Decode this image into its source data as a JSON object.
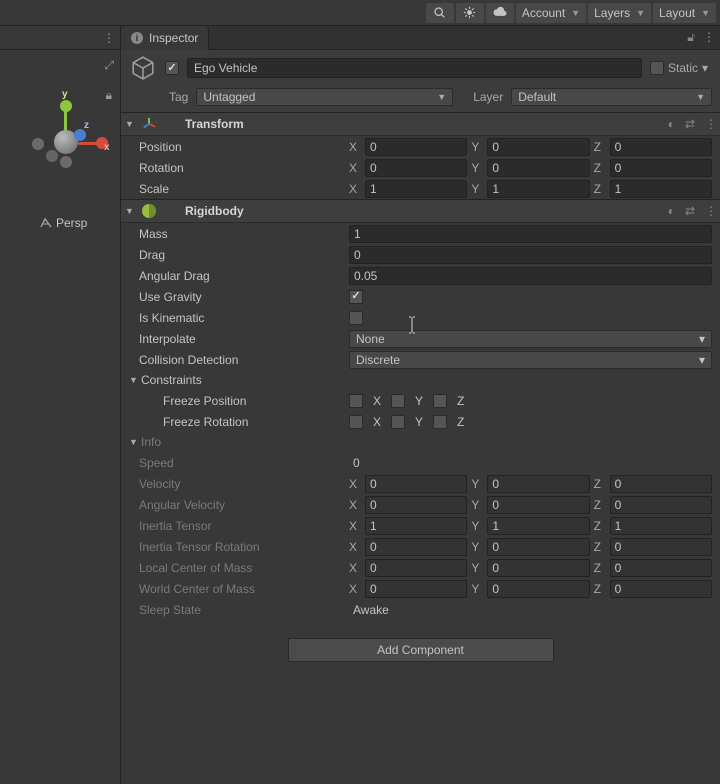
{
  "toolbar": {
    "account": "Account",
    "layers": "Layers",
    "layout": "Layout"
  },
  "inspector": {
    "tab_label": "Inspector",
    "object_name": "Ego Vehicle",
    "static_label": "Static",
    "tag_label": "Tag",
    "tag_value": "Untagged",
    "layer_label": "Layer",
    "layer_value": "Default"
  },
  "scene": {
    "persp": "Persp",
    "axis_x": "x",
    "axis_y": "y",
    "axis_z": "z"
  },
  "transform": {
    "title": "Transform",
    "position": "Position",
    "rotation": "Rotation",
    "scale": "Scale",
    "px": "0",
    "py": "0",
    "pz": "0",
    "rx": "0",
    "ry": "0",
    "rz": "0",
    "sx": "1",
    "sy": "1",
    "sz": "1"
  },
  "axis": {
    "X": "X",
    "Y": "Y",
    "Z": "Z"
  },
  "rigidbody": {
    "title": "Rigidbody",
    "mass_label": "Mass",
    "mass": "1",
    "drag_label": "Drag",
    "drag": "0",
    "angdrag_label": "Angular Drag",
    "angdrag": "0.05",
    "gravity_label": "Use Gravity",
    "kinematic_label": "Is Kinematic",
    "interpolate_label": "Interpolate",
    "interpolate": "None",
    "collision_label": "Collision Detection",
    "collision": "Discrete",
    "constraints_label": "Constraints",
    "freeze_pos": "Freeze Position",
    "freeze_rot": "Freeze Rotation",
    "info_label": "Info",
    "speed_label": "Speed",
    "speed": "0",
    "velocity_label": "Velocity",
    "angvel_label": "Angular Velocity",
    "tensor_label": "Inertia Tensor",
    "tensorrot_label": "Inertia Tensor Rotation",
    "localcom_label": "Local Center of Mass",
    "worldcom_label": "World Center of Mass",
    "sleep_label": "Sleep State",
    "sleep": "Awake",
    "vx": "0",
    "vy": "0",
    "vz": "0",
    "avx": "0",
    "avy": "0",
    "avz": "0",
    "tx": "1",
    "ty": "1",
    "tz": "1",
    "trx": "0",
    "try": "0",
    "trz": "0",
    "lcx": "0",
    "lcy": "0",
    "lcz": "0",
    "wcx": "0",
    "wcy": "0",
    "wcz": "0"
  },
  "add_component": "Add Component"
}
